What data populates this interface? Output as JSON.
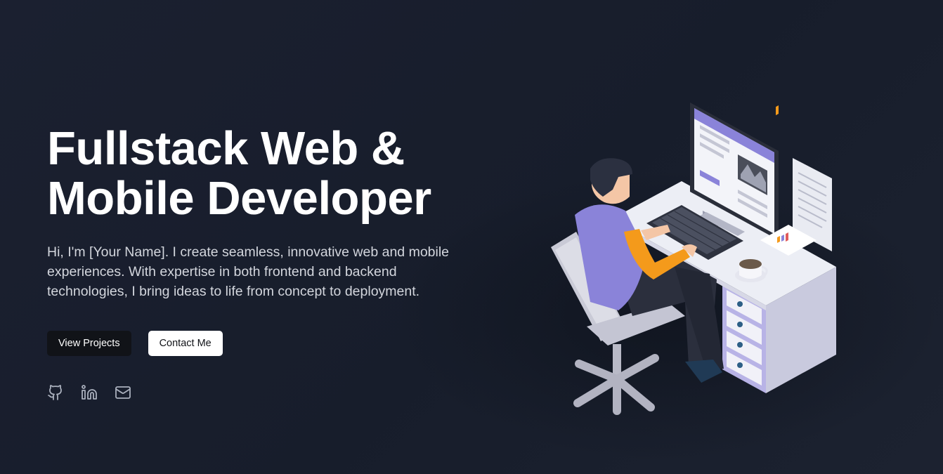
{
  "hero": {
    "headline_line1": "Fullstack Web &",
    "headline_line2": "Mobile Developer",
    "intro": "Hi, I'm [Your Name]. I create seamless, innovative web and mobile experiences. With expertise in both frontend and backend technologies, I bring ideas to life from concept to deployment.",
    "primary_button": "View Projects",
    "secondary_button": "Contact Me"
  },
  "socials": [
    {
      "icon": "github-icon"
    },
    {
      "icon": "linkedin-icon"
    },
    {
      "icon": "mail-icon"
    }
  ],
  "colors": {
    "background": "#1a1f2c",
    "text": "#ffffff",
    "muted_text": "#d3d6dd",
    "accent": "#8a83d9",
    "orange": "#f49a1b"
  }
}
